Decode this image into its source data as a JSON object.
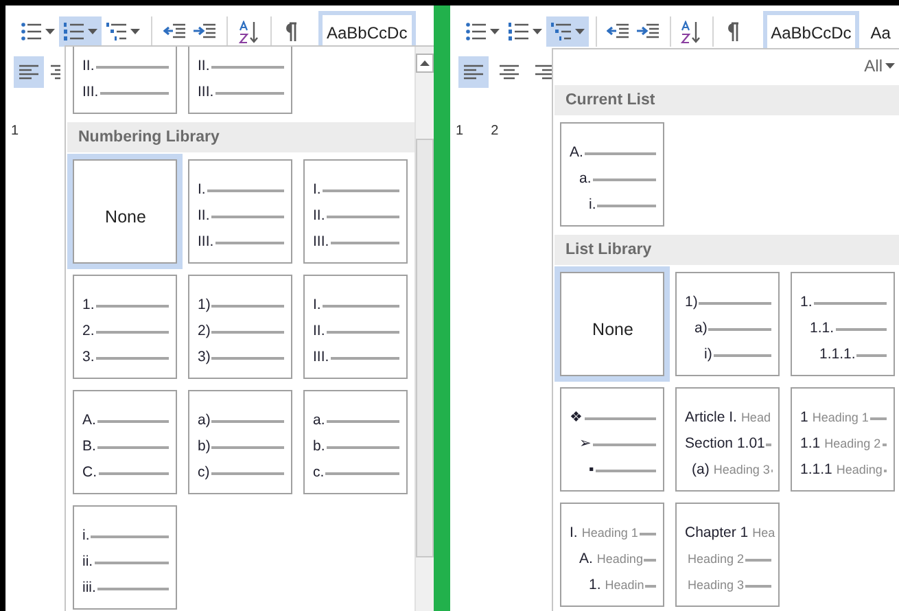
{
  "panels": [
    {
      "ribbon": {
        "groups": [
          [
            {
              "kind": "bullets",
              "selected": false
            },
            {
              "kind": "numbering",
              "selected": true
            },
            {
              "kind": "multilevel",
              "selected": false
            }
          ],
          [
            {
              "kind": "decrease-indent",
              "selected": false
            },
            {
              "kind": "increase-indent",
              "selected": false
            }
          ],
          [
            {
              "kind": "sort",
              "selected": false
            }
          ],
          [
            {
              "kind": "pilcrow",
              "selected": false
            }
          ]
        ],
        "styles": [
          {
            "sample": "AaBbCcDc",
            "selected": true
          }
        ],
        "align": [
          {
            "kind": "left",
            "selected": true
          },
          {
            "kind": "center",
            "selected": false
          }
        ],
        "ruler": [
          "1"
        ]
      },
      "menu": {
        "scrollbar": true,
        "sections": [
          {
            "cut_off": true,
            "tiles": [
              {
                "kind": "list",
                "selected": false,
                "items": [
                  {
                    "marker": "II."
                  },
                  {
                    "marker": "III."
                  }
                ]
              },
              {
                "kind": "list",
                "selected": false,
                "items": [
                  {
                    "marker": "II."
                  },
                  {
                    "marker": "III."
                  }
                ]
              }
            ]
          },
          {
            "title": "Numbering Library",
            "tiles": [
              {
                "kind": "none",
                "selected": true,
                "label": "None"
              },
              {
                "kind": "list",
                "selected": false,
                "items": [
                  {
                    "marker": "I."
                  },
                  {
                    "marker": "II."
                  },
                  {
                    "marker": "III."
                  }
                ]
              },
              {
                "kind": "list",
                "selected": false,
                "items": [
                  {
                    "marker": "I."
                  },
                  {
                    "marker": "II."
                  },
                  {
                    "marker": "III."
                  }
                ]
              },
              {
                "kind": "list",
                "selected": false,
                "items": [
                  {
                    "marker": "1."
                  },
                  {
                    "marker": "2."
                  },
                  {
                    "marker": "3."
                  }
                ]
              },
              {
                "kind": "list",
                "selected": false,
                "items": [
                  {
                    "marker": "1)"
                  },
                  {
                    "marker": "2)"
                  },
                  {
                    "marker": "3)"
                  }
                ]
              },
              {
                "kind": "list",
                "selected": false,
                "items": [
                  {
                    "marker": "I."
                  },
                  {
                    "marker": "II."
                  },
                  {
                    "marker": "III."
                  }
                ]
              },
              {
                "kind": "list",
                "selected": false,
                "items": [
                  {
                    "marker": "A."
                  },
                  {
                    "marker": "B."
                  },
                  {
                    "marker": "C."
                  }
                ]
              },
              {
                "kind": "list",
                "selected": false,
                "items": [
                  {
                    "marker": "a)"
                  },
                  {
                    "marker": "b)"
                  },
                  {
                    "marker": "c)"
                  }
                ]
              },
              {
                "kind": "list",
                "selected": false,
                "items": [
                  {
                    "marker": "a."
                  },
                  {
                    "marker": "b."
                  },
                  {
                    "marker": "c."
                  }
                ]
              },
              {
                "kind": "list",
                "selected": false,
                "items": [
                  {
                    "marker": "i."
                  },
                  {
                    "marker": "ii."
                  },
                  {
                    "marker": "iii."
                  }
                ]
              }
            ]
          }
        ]
      }
    },
    {
      "ribbon": {
        "groups": [
          [
            {
              "kind": "bullets",
              "selected": false
            },
            {
              "kind": "numbering",
              "selected": false
            },
            {
              "kind": "multilevel",
              "selected": true
            }
          ],
          [
            {
              "kind": "decrease-indent",
              "selected": false
            },
            {
              "kind": "increase-indent",
              "selected": false
            }
          ],
          [
            {
              "kind": "sort",
              "selected": false
            }
          ],
          [
            {
              "kind": "pilcrow",
              "selected": false
            }
          ]
        ],
        "styles": [
          {
            "sample": "AaBbCcDc",
            "selected": true
          },
          {
            "sample": "Aa",
            "selected": false
          }
        ],
        "align": [
          {
            "kind": "left",
            "selected": true
          },
          {
            "kind": "center",
            "selected": false
          },
          {
            "kind": "right",
            "selected": false
          }
        ],
        "ruler": [
          "1",
          "2"
        ]
      },
      "menu": {
        "filter": "All",
        "sections": [
          {
            "title": "Current List",
            "tiles": [
              {
                "kind": "list",
                "selected": false,
                "items": [
                  {
                    "marker": "A.",
                    "children": [
                      {
                        "marker": "a.",
                        "children": [
                          {
                            "marker": "i."
                          }
                        ]
                      }
                    ]
                  }
                ]
              }
            ]
          },
          {
            "title": "List Library",
            "tiles": [
              {
                "kind": "none",
                "selected": true,
                "label": "None"
              },
              {
                "kind": "list",
                "selected": false,
                "items": [
                  {
                    "marker": "1)",
                    "children": [
                      {
                        "marker": "a)",
                        "children": [
                          {
                            "marker": "i)"
                          }
                        ]
                      }
                    ]
                  }
                ]
              },
              {
                "kind": "list",
                "selected": false,
                "items": [
                  {
                    "marker": "1.",
                    "children": [
                      {
                        "marker": "1.1.",
                        "children": [
                          {
                            "marker": "1.1.1."
                          }
                        ]
                      }
                    ]
                  }
                ]
              },
              {
                "kind": "list",
                "selected": false,
                "items": [
                  {
                    "marker": "❖",
                    "children": [
                      {
                        "marker": "➢",
                        "children": [
                          {
                            "marker": "▪"
                          }
                        ]
                      }
                    ]
                  }
                ]
              },
              {
                "kind": "list",
                "selected": false,
                "items": [
                  {
                    "marker": "Article I.",
                    "text": "Head"
                  },
                  {
                    "marker": "Section 1.01"
                  },
                  {
                    "marker": "(a)",
                    "text": "Heading 3",
                    "indent": true
                  }
                ]
              },
              {
                "kind": "list",
                "selected": false,
                "items": [
                  {
                    "marker": "1",
                    "text": "Heading 1"
                  },
                  {
                    "marker": "1.1",
                    "text": "Heading 2"
                  },
                  {
                    "marker": "1.1.1",
                    "text": "Heading"
                  }
                ]
              },
              {
                "kind": "list",
                "selected": false,
                "items": [
                  {
                    "marker": "I.",
                    "text": "Heading 1",
                    "children": [
                      {
                        "marker": "A.",
                        "text": "Heading",
                        "children": [
                          {
                            "marker": "1.",
                            "text": "Headin"
                          }
                        ]
                      }
                    ]
                  }
                ]
              },
              {
                "kind": "list",
                "selected": false,
                "items": [
                  {
                    "marker": "Chapter 1",
                    "text": "Hea"
                  },
                  {
                    "text": "Heading 2"
                  },
                  {
                    "text": "Heading 3"
                  }
                ]
              }
            ]
          }
        ]
      }
    }
  ]
}
